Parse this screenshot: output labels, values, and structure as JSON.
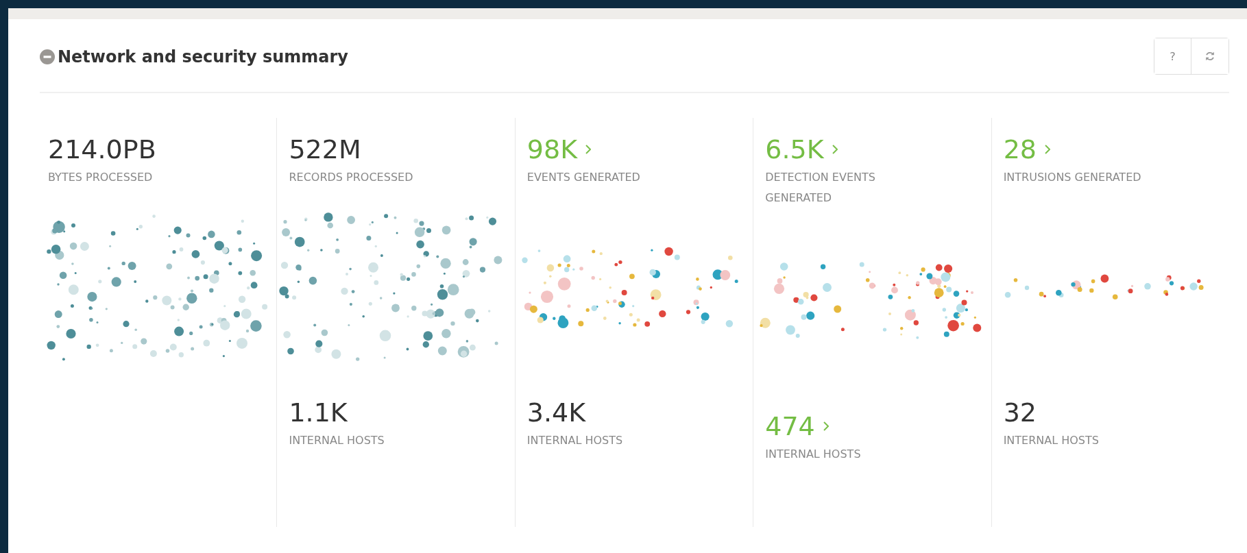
{
  "panel": {
    "title": "Network and security summary",
    "collapsed": false,
    "buttons": [
      {
        "kind": "help",
        "label": "?"
      },
      {
        "kind": "refresh"
      }
    ]
  },
  "columns": [
    {
      "top": {
        "value": "214.0PB",
        "label": "BYTES PROCESSED",
        "link": false
      },
      "kind": "mono"
    },
    {
      "top": {
        "value": "522M",
        "label": "RECORDS PROCESSED",
        "link": false
      },
      "kind": "mono",
      "bottom": {
        "value": "1.1K",
        "label": "INTERNAL HOSTS",
        "link": false
      }
    },
    {
      "top": {
        "value": "98K",
        "label": "EVENTS GENERATED",
        "link": true
      },
      "kind": "multi",
      "bottom": {
        "value": "3.4K",
        "label": "INTERNAL HOSTS",
        "link": false
      }
    },
    {
      "top": {
        "value": "6.5K",
        "label": "DETECTION EVENTS GENERATED",
        "link": true
      },
      "kind": "multi",
      "bottom": {
        "value": "474",
        "label": "INTERNAL HOSTS",
        "link": true
      }
    },
    {
      "top": {
        "value": "28",
        "label": "INTRUSIONS GENERATED",
        "link": true
      },
      "kind": "sparse",
      "bottom": {
        "value": "32",
        "label": "INTERNAL HOSTS",
        "link": false
      }
    }
  ]
}
